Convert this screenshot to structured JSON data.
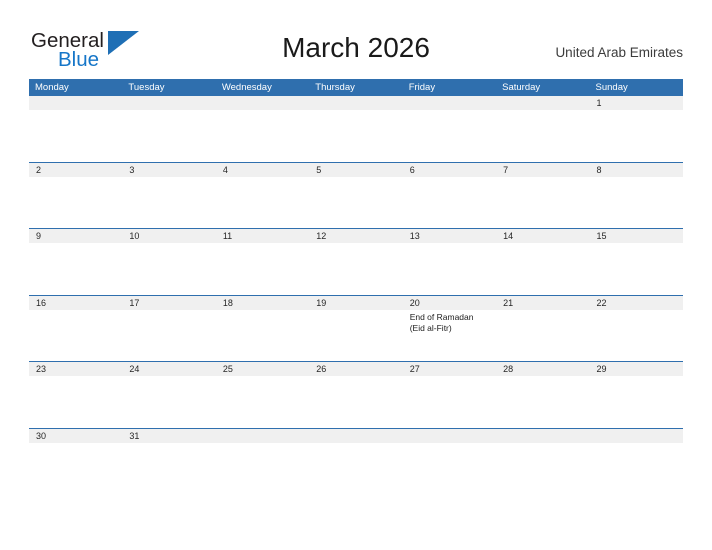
{
  "brand": {
    "name_part1": "General",
    "name_part2": "Blue",
    "flag_icon": "triangle-flag-icon",
    "color_dark": "#231f20",
    "color_blue": "#1676c8",
    "flag_color": "#1f6fb5"
  },
  "header": {
    "title": "March 2026",
    "country": "United Arab Emirates"
  },
  "colors": {
    "header_blue": "#2f6fae",
    "row_divider": "#2f6fae",
    "day_band_gray": "#f0f0f0",
    "text_dark": "#262626"
  },
  "weekdays": [
    "Monday",
    "Tuesday",
    "Wednesday",
    "Thursday",
    "Friday",
    "Saturday",
    "Sunday"
  ],
  "weeks": [
    {
      "days": [
        {
          "number": "",
          "events": ""
        },
        {
          "number": "",
          "events": ""
        },
        {
          "number": "",
          "events": ""
        },
        {
          "number": "",
          "events": ""
        },
        {
          "number": "",
          "events": ""
        },
        {
          "number": "",
          "events": ""
        },
        {
          "number": "1",
          "events": ""
        }
      ]
    },
    {
      "days": [
        {
          "number": "2",
          "events": ""
        },
        {
          "number": "3",
          "events": ""
        },
        {
          "number": "4",
          "events": ""
        },
        {
          "number": "5",
          "events": ""
        },
        {
          "number": "6",
          "events": ""
        },
        {
          "number": "7",
          "events": ""
        },
        {
          "number": "8",
          "events": ""
        }
      ]
    },
    {
      "days": [
        {
          "number": "9",
          "events": ""
        },
        {
          "number": "10",
          "events": ""
        },
        {
          "number": "11",
          "events": ""
        },
        {
          "number": "12",
          "events": ""
        },
        {
          "number": "13",
          "events": ""
        },
        {
          "number": "14",
          "events": ""
        },
        {
          "number": "15",
          "events": ""
        }
      ]
    },
    {
      "days": [
        {
          "number": "16",
          "events": ""
        },
        {
          "number": "17",
          "events": ""
        },
        {
          "number": "18",
          "events": ""
        },
        {
          "number": "19",
          "events": ""
        },
        {
          "number": "20",
          "events": "End of Ramadan\n(Eid al-Fitr)"
        },
        {
          "number": "21",
          "events": ""
        },
        {
          "number": "22",
          "events": ""
        }
      ]
    },
    {
      "days": [
        {
          "number": "23",
          "events": ""
        },
        {
          "number": "24",
          "events": ""
        },
        {
          "number": "25",
          "events": ""
        },
        {
          "number": "26",
          "events": ""
        },
        {
          "number": "27",
          "events": ""
        },
        {
          "number": "28",
          "events": ""
        },
        {
          "number": "29",
          "events": ""
        }
      ]
    },
    {
      "days": [
        {
          "number": "30",
          "events": ""
        },
        {
          "number": "31",
          "events": ""
        },
        {
          "number": "",
          "events": ""
        },
        {
          "number": "",
          "events": ""
        },
        {
          "number": "",
          "events": ""
        },
        {
          "number": "",
          "events": ""
        },
        {
          "number": "",
          "events": ""
        }
      ]
    }
  ]
}
